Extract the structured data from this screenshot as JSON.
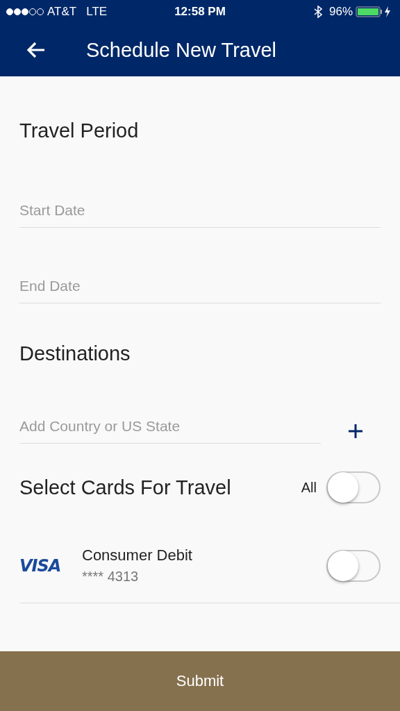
{
  "status_bar": {
    "carrier": "AT&T",
    "network": "LTE",
    "time": "12:58 PM",
    "battery": "96%"
  },
  "header": {
    "title": "Schedule New Travel"
  },
  "travel_period": {
    "title": "Travel Period",
    "fields": [
      {
        "placeholder": "Start Date"
      },
      {
        "placeholder": "End Date"
      }
    ]
  },
  "destinations": {
    "title": "Destinations",
    "field": {
      "placeholder": "Add Country or US State"
    }
  },
  "cards": {
    "title": "Select Cards For Travel",
    "all": {
      "label": "All",
      "on": false
    },
    "items": [
      {
        "brand": "VISA",
        "name": "Consumer Debit",
        "number": "**** 4313",
        "on": false
      }
    ]
  },
  "submit": {
    "label": "Submit"
  }
}
